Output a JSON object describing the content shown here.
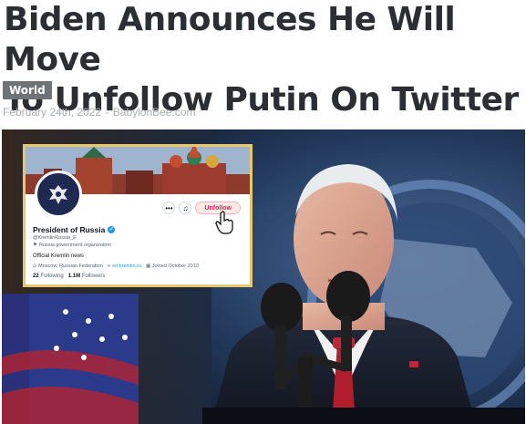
{
  "article": {
    "headline_line1": "Biden Announces He Will Move",
    "headline_line2": "To Unfollow Putin On Twitter",
    "category": "World",
    "date": "February 24th, 2022",
    "separator": "-",
    "source": "BabylonBee.com"
  },
  "twitter_card": {
    "unfollow_label": "Unfollow",
    "more_icon": "ellipsis-icon",
    "notify_icon": "bell-plus-icon",
    "display_name": "President of Russia",
    "handle": "@KremlinRussia_E",
    "org_label": "Russia government organization",
    "bio": "Official Kremlin news",
    "location": "Moscow, Russian Federation",
    "website": "en.kremlin.ru",
    "joined": "Joined October 2010",
    "following_count": "22",
    "following_label": "Following",
    "followers_count": "1.1M",
    "followers_label": "Followers"
  },
  "colors": {
    "headline": "#2b2f33",
    "category_bg": "#6e7377",
    "byline": "#a9adb1",
    "card_border": "#e8c76c",
    "unfollow_red": "#e0245e",
    "twitter_blue": "#1d9bf0"
  }
}
